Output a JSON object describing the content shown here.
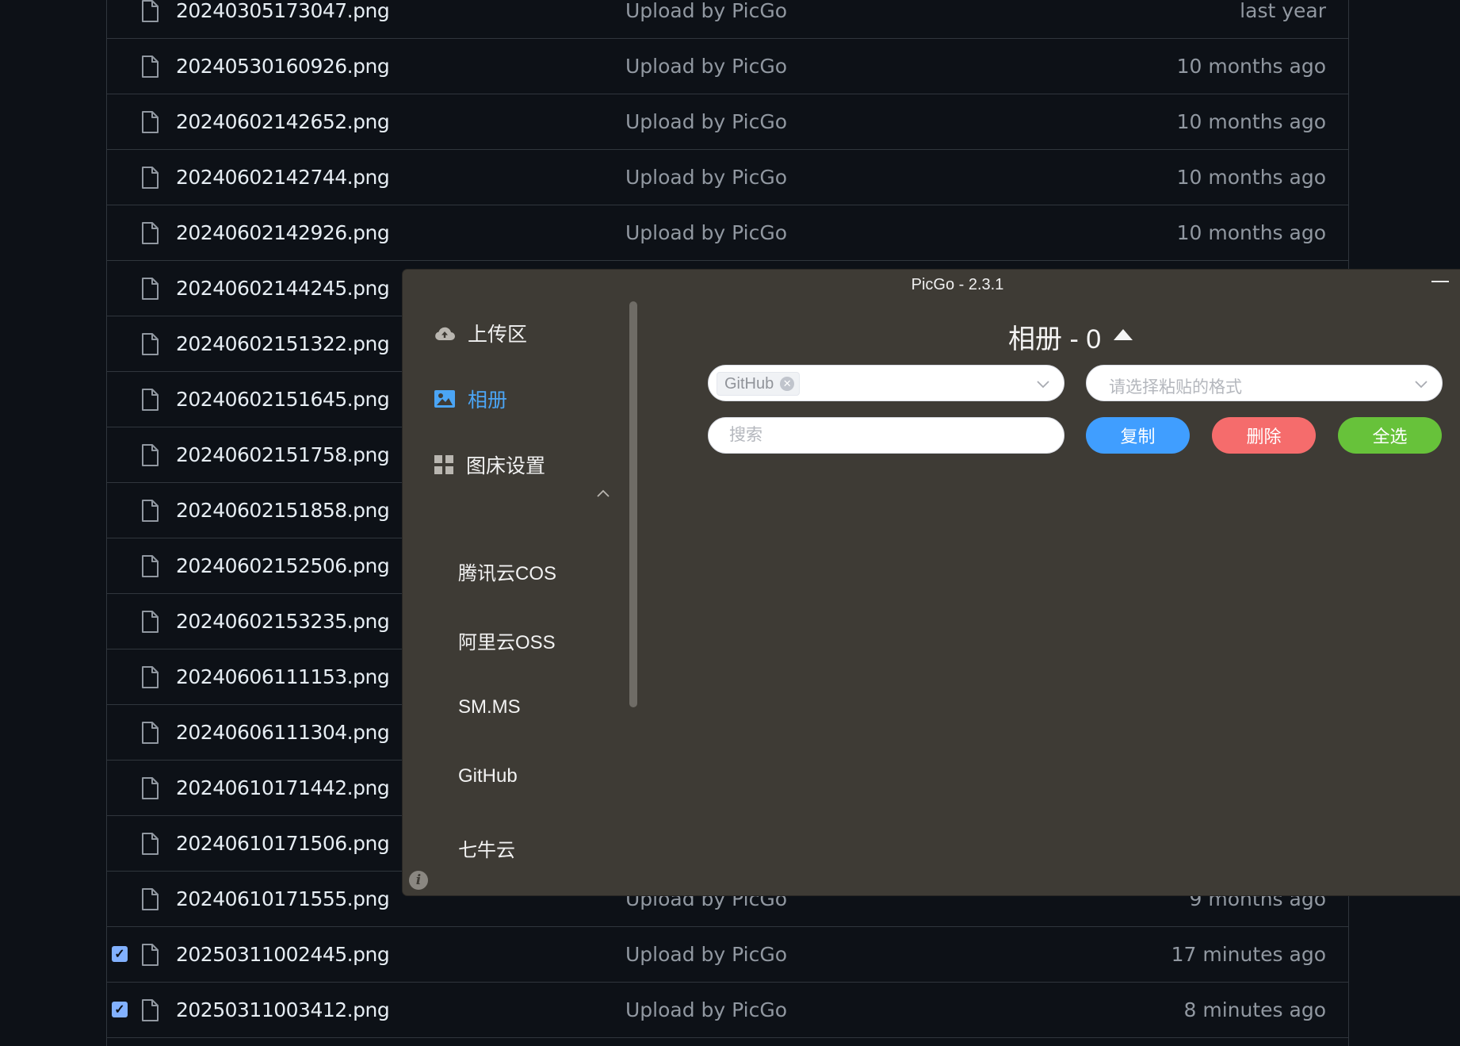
{
  "file_list": {
    "rows": [
      {
        "name": "20240305173047.png",
        "message": "Upload by PicGo",
        "time": "last year",
        "checked": false
      },
      {
        "name": "20240530160926.png",
        "message": "Upload by PicGo",
        "time": "10 months ago",
        "checked": false
      },
      {
        "name": "20240602142652.png",
        "message": "Upload by PicGo",
        "time": "10 months ago",
        "checked": false
      },
      {
        "name": "20240602142744.png",
        "message": "Upload by PicGo",
        "time": "10 months ago",
        "checked": false
      },
      {
        "name": "20240602142926.png",
        "message": "Upload by PicGo",
        "time": "10 months ago",
        "checked": false
      },
      {
        "name": "20240602144245.png",
        "message": "",
        "time": "",
        "checked": false
      },
      {
        "name": "20240602151322.png",
        "message": "",
        "time": "",
        "checked": false
      },
      {
        "name": "20240602151645.png",
        "message": "",
        "time": "",
        "checked": false
      },
      {
        "name": "20240602151758.png",
        "message": "",
        "time": "",
        "checked": false
      },
      {
        "name": "20240602151858.png",
        "message": "",
        "time": "",
        "checked": false
      },
      {
        "name": "20240602152506.png",
        "message": "",
        "time": "",
        "checked": false
      },
      {
        "name": "20240602153235.png",
        "message": "",
        "time": "",
        "checked": false
      },
      {
        "name": "20240606111153.png",
        "message": "",
        "time": "",
        "checked": false
      },
      {
        "name": "20240606111304.png",
        "message": "",
        "time": "",
        "checked": false
      },
      {
        "name": "20240610171442.png",
        "message": "",
        "time": "",
        "checked": false
      },
      {
        "name": "20240610171506.png",
        "message": "",
        "time": "",
        "checked": false
      },
      {
        "name": "20240610171555.png",
        "message": "Upload by PicGo",
        "time": "9 months ago",
        "checked": false
      },
      {
        "name": "20250311002445.png",
        "message": "Upload by PicGo",
        "time": "17 minutes ago",
        "checked": true
      },
      {
        "name": "20250311003412.png",
        "message": "Upload by PicGo",
        "time": "8 minutes ago",
        "checked": true
      }
    ]
  },
  "picgo": {
    "window_title": "PicGo - 2.3.1",
    "sidebar": {
      "upload_label": "上传区",
      "album_label": "相册",
      "settings_label": "图床设置",
      "sub_items": [
        "腾讯云COS",
        "阿里云OSS",
        "SM.MS",
        "GitHub",
        "七牛云"
      ]
    },
    "album": {
      "title": "相册 - 0",
      "pic_bed_tag": "GitHub",
      "paste_format_placeholder": "请选择粘贴的格式",
      "search_placeholder": "搜索",
      "copy_label": "复制",
      "delete_label": "删除",
      "select_all_label": "全选"
    },
    "colors": {
      "window_bg": "#3e3b35",
      "active_nav": "#4ba5f5",
      "copy_button": "#409eff",
      "delete_button": "#f56c6c",
      "select_all_button": "#67c23a"
    },
    "icons": {
      "upload": "cloud-upload-icon",
      "album": "image-icon",
      "settings": "grid-icon",
      "expand": "chevron-up-icon",
      "info": "info-icon",
      "minimize": "minimize-icon"
    }
  }
}
